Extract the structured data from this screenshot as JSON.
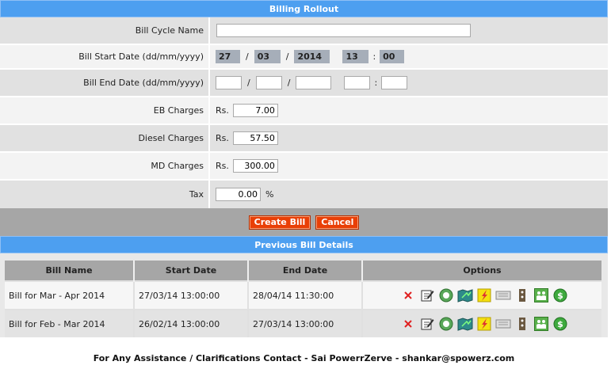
{
  "form": {
    "title": "Billing Rollout",
    "bill_cycle_label": "Bill Cycle Name",
    "bill_cycle_value": "",
    "start_label": "Bill Start Date (dd/mm/yyyy)",
    "start_day": "27",
    "start_month": "03",
    "start_year": "2014",
    "start_hour": "13",
    "start_min": "00",
    "end_label": "Bill End Date (dd/mm/yyyy)",
    "end_day": "",
    "end_month": "",
    "end_year": "",
    "end_hour": "",
    "end_min": "",
    "date_sep": "/",
    "time_sep": ":",
    "eb_label": "EB Charges",
    "eb_value": "7.00",
    "diesel_label": "Diesel Charges",
    "diesel_value": "57.50",
    "md_label": "MD Charges",
    "md_value": "300.00",
    "currency": "Rs.",
    "tax_label": "Tax",
    "tax_value": "0.00",
    "tax_unit": "%",
    "create_button": "Create Bill",
    "cancel_button": "Cancel"
  },
  "previous": {
    "title": "Previous Bill Details",
    "headers": [
      "Bill Name",
      "Start Date",
      "End Date",
      "Options"
    ],
    "rows": [
      {
        "name": "Bill for Mar - Apr 2014",
        "start": "27/03/14 13:00:00",
        "end": "28/04/14 11:30:00"
      },
      {
        "name": "Bill for Feb - Mar 2014",
        "start": "26/02/14 13:00:00",
        "end": "27/03/14 13:00:00"
      }
    ],
    "option_icons": [
      "delete-icon",
      "edit-icon",
      "seal-icon",
      "map-icon",
      "power-icon",
      "device-icon",
      "meter-icon",
      "users-icon",
      "money-icon"
    ]
  },
  "footer": {
    "text": "For Any Assistance / Clarifications Contact - Sai PowerrZerve - shankar@spowerz.com"
  }
}
